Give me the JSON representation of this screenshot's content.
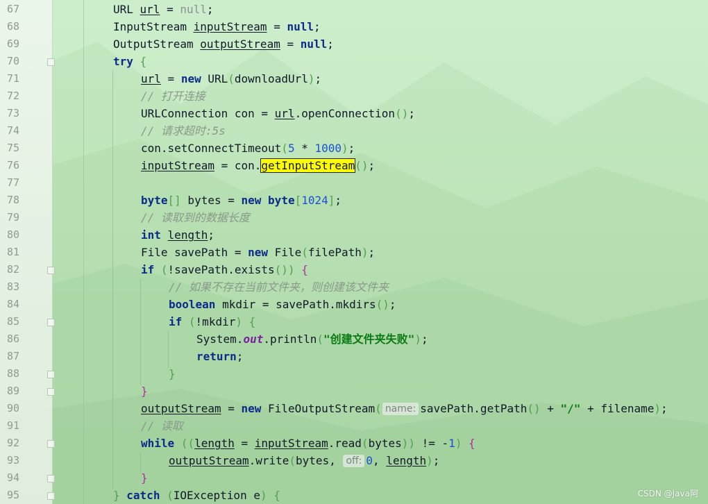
{
  "colors": {
    "keyword": "#0b2a8a",
    "number": "#1b4fd6",
    "comment": "#8a998a",
    "string": "#0a7a12",
    "field": "#7a1f9e",
    "highlight": "#ffff00",
    "background": "#c6eac3"
  },
  "lines": [
    {
      "num": "67",
      "tokens": [
        {
          "t": "URL "
        },
        {
          "t": "url",
          "c": "ul"
        },
        {
          "t": " = "
        },
        {
          "t": "null",
          "c": "nul"
        },
        {
          "t": ";"
        }
      ]
    },
    {
      "num": "68",
      "tokens": [
        {
          "t": "InputStream "
        },
        {
          "t": "inputStream",
          "c": "ul"
        },
        {
          "t": " = "
        },
        {
          "t": "null",
          "c": "kw"
        },
        {
          "t": ";"
        }
      ]
    },
    {
      "num": "69",
      "tokens": [
        {
          "t": "OutputStream "
        },
        {
          "t": "outputStream",
          "c": "ul"
        },
        {
          "t": " = "
        },
        {
          "t": "null",
          "c": "kw"
        },
        {
          "t": ";"
        }
      ]
    },
    {
      "num": "70",
      "tokens": [
        {
          "t": "try",
          "c": "kw"
        },
        {
          "t": " "
        },
        {
          "t": "{",
          "c": "br-g"
        }
      ]
    },
    {
      "num": "71",
      "tokens": [
        {
          "t": "url",
          "c": "ul"
        },
        {
          "t": " = "
        },
        {
          "t": "new",
          "c": "kw"
        },
        {
          "t": " URL"
        },
        {
          "t": "(",
          "c": "br-g"
        },
        {
          "t": "downloadUrl"
        },
        {
          "t": ")",
          "c": "br-g"
        },
        {
          "t": ";"
        }
      ]
    },
    {
      "num": "72",
      "tokens": [
        {
          "t": "// 打开连接",
          "c": "cmt"
        }
      ]
    },
    {
      "num": "73",
      "tokens": [
        {
          "t": "URLConnection con = "
        },
        {
          "t": "url",
          "c": "ul"
        },
        {
          "t": ".openConnection"
        },
        {
          "t": "()",
          "c": "br-g"
        },
        {
          "t": ";"
        }
      ]
    },
    {
      "num": "74",
      "tokens": [
        {
          "t": "// 请求超时:5s",
          "c": "cmt"
        }
      ]
    },
    {
      "num": "75",
      "tokens": [
        {
          "t": "con.setConnectTimeout"
        },
        {
          "t": "(",
          "c": "br-g"
        },
        {
          "t": "5",
          "c": "num"
        },
        {
          "t": " * "
        },
        {
          "t": "1000",
          "c": "num"
        },
        {
          "t": ")",
          "c": "br-g"
        },
        {
          "t": ";"
        }
      ]
    },
    {
      "num": "76",
      "tokens": [
        {
          "t": "inputStream",
          "c": "ul"
        },
        {
          "t": " = con."
        },
        {
          "t": "getInputStream",
          "c": "hl"
        },
        {
          "t": "()",
          "c": "br-g"
        },
        {
          "t": ";"
        }
      ]
    },
    {
      "num": "77",
      "tokens": []
    },
    {
      "num": "78",
      "tokens": [
        {
          "t": "byte",
          "c": "kw"
        },
        {
          "t": "[]",
          "c": "br-g"
        },
        {
          "t": " bytes = "
        },
        {
          "t": "new",
          "c": "kw"
        },
        {
          "t": " "
        },
        {
          "t": "byte",
          "c": "kw"
        },
        {
          "t": "[",
          "c": "br-g"
        },
        {
          "t": "1024",
          "c": "num"
        },
        {
          "t": "]",
          "c": "br-g"
        },
        {
          "t": ";"
        }
      ]
    },
    {
      "num": "79",
      "tokens": [
        {
          "t": "// 读取到的数据长度",
          "c": "cmt"
        }
      ]
    },
    {
      "num": "80",
      "tokens": [
        {
          "t": "int",
          "c": "kw"
        },
        {
          "t": " "
        },
        {
          "t": "length",
          "c": "ul"
        },
        {
          "t": ";"
        }
      ]
    },
    {
      "num": "81",
      "tokens": [
        {
          "t": "File savePath = "
        },
        {
          "t": "new",
          "c": "kw"
        },
        {
          "t": " File"
        },
        {
          "t": "(",
          "c": "br-g"
        },
        {
          "t": "filePath"
        },
        {
          "t": ")",
          "c": "br-g"
        },
        {
          "t": ";"
        }
      ]
    },
    {
      "num": "82",
      "tokens": [
        {
          "t": "if",
          "c": "kw"
        },
        {
          "t": " "
        },
        {
          "t": "(",
          "c": "br-g"
        },
        {
          "t": "!savePath.exists"
        },
        {
          "t": "()",
          "c": "br-g"
        },
        {
          "t": ")",
          "c": "br-g"
        },
        {
          "t": " "
        },
        {
          "t": "{",
          "c": "br-p"
        }
      ]
    },
    {
      "num": "83",
      "tokens": [
        {
          "t": "// 如果不存在当前文件夹，则创建该文件夹",
          "c": "cmt"
        }
      ]
    },
    {
      "num": "84",
      "tokens": [
        {
          "t": "boolean",
          "c": "kw"
        },
        {
          "t": " mkdir = savePath.mkdirs"
        },
        {
          "t": "()",
          "c": "br-g"
        },
        {
          "t": ";"
        }
      ]
    },
    {
      "num": "85",
      "tokens": [
        {
          "t": "if",
          "c": "kw"
        },
        {
          "t": " "
        },
        {
          "t": "(",
          "c": "br-g"
        },
        {
          "t": "!mkdir"
        },
        {
          "t": ")",
          "c": "br-g"
        },
        {
          "t": " "
        },
        {
          "t": "{",
          "c": "br-g"
        }
      ]
    },
    {
      "num": "86",
      "tokens": [
        {
          "t": "System."
        },
        {
          "t": "out",
          "c": "fld"
        },
        {
          "t": ".println"
        },
        {
          "t": "(",
          "c": "br-g"
        },
        {
          "t": "\"创建文件夹失败\"",
          "c": "str"
        },
        {
          "t": ")",
          "c": "br-g"
        },
        {
          "t": ";"
        }
      ]
    },
    {
      "num": "87",
      "tokens": [
        {
          "t": "return",
          "c": "kw"
        },
        {
          "t": ";"
        }
      ]
    },
    {
      "num": "88",
      "tokens": [
        {
          "t": "}",
          "c": "br-g"
        }
      ]
    },
    {
      "num": "89",
      "tokens": [
        {
          "t": "}",
          "c": "br-p"
        }
      ]
    },
    {
      "num": "90",
      "tokens": [
        {
          "t": "outputStream",
          "c": "ul"
        },
        {
          "t": " = "
        },
        {
          "t": "new",
          "c": "kw"
        },
        {
          "t": " FileOutputStream"
        },
        {
          "t": "(",
          "c": "br-g"
        },
        {
          "t": "name:",
          "c": "hint"
        },
        {
          "t": "savePath.getPath"
        },
        {
          "t": "()",
          "c": "br-g"
        },
        {
          "t": " + "
        },
        {
          "t": "\"/\"",
          "c": "str"
        },
        {
          "t": " + filename"
        },
        {
          "t": ")",
          "c": "br-g"
        },
        {
          "t": ";"
        }
      ]
    },
    {
      "num": "91",
      "tokens": [
        {
          "t": "// 读取",
          "c": "cmt"
        }
      ]
    },
    {
      "num": "92",
      "tokens": [
        {
          "t": "while",
          "c": "kw"
        },
        {
          "t": " "
        },
        {
          "t": "((",
          "c": "br-g"
        },
        {
          "t": "length",
          "c": "ul"
        },
        {
          "t": " = "
        },
        {
          "t": "inputStream",
          "c": "ul"
        },
        {
          "t": ".read"
        },
        {
          "t": "(",
          "c": "br-g"
        },
        {
          "t": "bytes"
        },
        {
          "t": "))",
          "c": "br-g"
        },
        {
          "t": " != -"
        },
        {
          "t": "1",
          "c": "num"
        },
        {
          "t": ")",
          "c": "br-g"
        },
        {
          "t": " "
        },
        {
          "t": "{",
          "c": "br-p"
        }
      ]
    },
    {
      "num": "93",
      "tokens": [
        {
          "t": "outputStream",
          "c": "ul"
        },
        {
          "t": ".write"
        },
        {
          "t": "(",
          "c": "br-g"
        },
        {
          "t": "bytes, "
        },
        {
          "t": "off:",
          "c": "hint"
        },
        {
          "t": "0",
          "c": "num"
        },
        {
          "t": ", "
        },
        {
          "t": "length",
          "c": "ul"
        },
        {
          "t": ")",
          "c": "br-g"
        },
        {
          "t": ";"
        }
      ]
    },
    {
      "num": "94",
      "tokens": [
        {
          "t": "}",
          "c": "br-p"
        }
      ]
    },
    {
      "num": "95",
      "tokens": [
        {
          "t": "}",
          "c": "br-g"
        },
        {
          "t": " "
        },
        {
          "t": "catch",
          "c": "kw"
        },
        {
          "t": " "
        },
        {
          "t": "(",
          "c": "br-g"
        },
        {
          "t": "IOException e"
        },
        {
          "t": ")",
          "c": "br-g"
        },
        {
          "t": " "
        },
        {
          "t": "{",
          "c": "br-g"
        }
      ]
    }
  ],
  "watermark": "CSDN @Java阿"
}
